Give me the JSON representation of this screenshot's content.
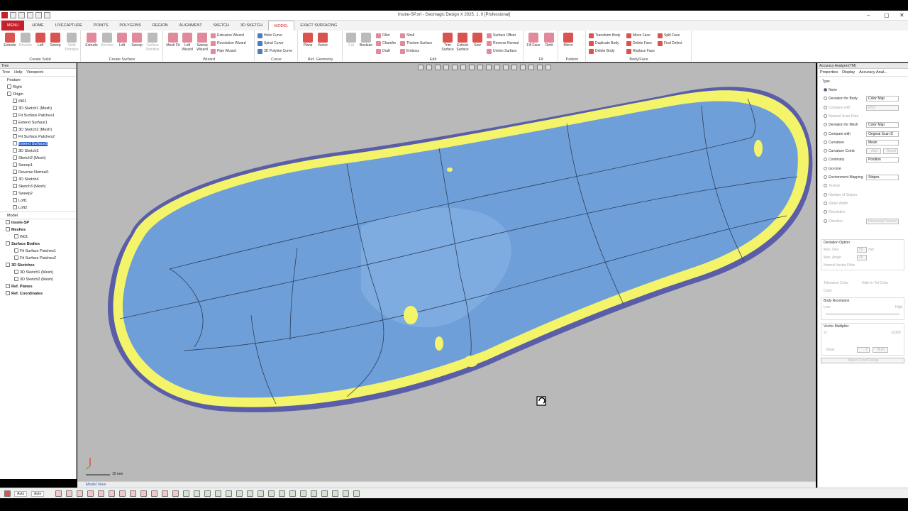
{
  "title": "Insole-SP.xrl - Geomagic Design X 2025. 1. 0 [Professional]",
  "window": {
    "minimize": "–",
    "restore": "▢",
    "close": "✕"
  },
  "menu_tabs": [
    "MENU",
    "HOME",
    "LIVECAPTURE",
    "POINTS",
    "POLYGONS",
    "REGION",
    "ALIGNMENT",
    "SKETCH",
    "3D SKETCH",
    "MODEL",
    "EXACT SURFACING"
  ],
  "active_tab": "MODEL",
  "ribbon": {
    "create_solid": {
      "label": "Create Solid",
      "buttons": [
        "Extrude",
        "Revolve",
        "Loft",
        "Sweep",
        "Solid Primitive"
      ]
    },
    "create_surface": {
      "label": "Create Surface",
      "buttons": [
        "Extrude",
        "Revolve",
        "Loft",
        "Sweep",
        "Surface Primitive"
      ]
    },
    "wizard": {
      "label": "Wizard",
      "buttons": [
        "Mesh Fit",
        "Loft Wizard",
        "Sweep Wizard"
      ],
      "small": [
        "Extrusion Wizard",
        "Revolution Wizard",
        "Pipe Wizard"
      ]
    },
    "curve": {
      "label": "Curve",
      "small": [
        "Helix Curve",
        "Spiral Curve",
        "3D Polyline Curve"
      ]
    },
    "ref_geometry": {
      "label": "Ref. Geometry",
      "buttons": [
        "Plane",
        "Vector"
      ]
    },
    "edit": {
      "label": "Edit",
      "buttons": [
        "Cut",
        "Boolean",
        "Trim Surface",
        "Extend Surface",
        "Sew"
      ],
      "small": [
        "Fillet",
        "Chamfer",
        "Draft",
        "Shell",
        "Thicken Surface",
        "Emboss",
        "Surface Offset",
        "Reverse Normal",
        "Untrim Surface"
      ]
    },
    "fit": {
      "label": "Fit",
      "buttons": [
        "Fill Face",
        "Refit"
      ]
    },
    "pattern": {
      "label": "Pattern",
      "buttons": [
        "Mirror"
      ]
    },
    "bodyface": {
      "label": "Body/Face",
      "small": [
        "Transform Body",
        "Duplicate Body",
        "Delete Body",
        "Move Face",
        "Delete Face",
        "Replace Face",
        "Split Face",
        "Find Defect"
      ]
    }
  },
  "left_panel": {
    "header": "Tree",
    "tabs": [
      "Tree",
      "Help",
      "Viewpoint"
    ],
    "feature_label": "Feature",
    "features": [
      "Right",
      "Origin",
      "iN01",
      "3D Sketch1 (Mesh)",
      "Fit Surface Patches1",
      "Extend Surface1",
      "3D Sketch2 (Mesh)",
      "Fit Surface Patches2",
      "Extend Surface2",
      "3D Sketch3",
      "Sketch2 (Mesh)",
      "Sweep1",
      "Reverse Normal1",
      "3D Sketch4",
      "Sketch3 (Mesh)",
      "Sweep2",
      "Loft1",
      "Loft2"
    ],
    "selected_feature": "Extend Surface2",
    "model_label": "Model",
    "model_tree": [
      {
        "label": "Insole-SP",
        "level": 0,
        "bold": true
      },
      {
        "label": "Meshes",
        "level": 0,
        "bold": true
      },
      {
        "label": "iN01",
        "level": 1
      },
      {
        "label": "Surface Bodies",
        "level": 0,
        "bold": true
      },
      {
        "label": "Fit Surface Patches1",
        "level": 1
      },
      {
        "label": "Fit Surface Patches2",
        "level": 1
      },
      {
        "label": "3D Sketches",
        "level": 0,
        "bold": true
      },
      {
        "label": "3D Sketch1 (Mesh)",
        "level": 1
      },
      {
        "label": "3D Sketch2 (Mesh)",
        "level": 1
      },
      {
        "label": "Ref. Planes",
        "level": 0,
        "bold": true
      },
      {
        "label": "Ref. Coordinates",
        "level": 0,
        "bold": true
      }
    ]
  },
  "canvas": {
    "scale_label": "10 mm",
    "tab": "Model View"
  },
  "right_panel": {
    "header": "Accuracy Analyzer(TM)",
    "tabs": [
      "Properties",
      "Display",
      "Accuracy Anal..."
    ],
    "type_label": "Type",
    "options": [
      {
        "label": "None",
        "value": "",
        "checked": true,
        "dim": false
      },
      {
        "label": "Deviation for Body",
        "value": "Color Map",
        "dim": false
      },
      {
        "label": "Compare with",
        "value": "iN01",
        "dim": true
      },
      {
        "label": "Nearest Scan Data",
        "value": "",
        "dim": true
      },
      {
        "label": "Deviation for Mesh",
        "value": "Color Map",
        "dim": false
      },
      {
        "label": "Compare with",
        "value": "Original Scan D",
        "dim": false
      },
      {
        "label": "Curvature",
        "value": "Mean",
        "dim": false
      },
      {
        "label": "Curvature Comb",
        "value": "",
        "dim": false
      },
      {
        "label": "Continuity",
        "value": "Position",
        "dim": false
      },
      {
        "label": "Iso-Line",
        "value": "",
        "dim": false
      },
      {
        "label": "Environment Mapping",
        "value": "Stripes",
        "dim": false
      },
      {
        "label": "Texture",
        "value": "",
        "dim": true
      },
      {
        "label": "Number of Stripes",
        "value": "",
        "dim": true
      },
      {
        "label": "Stripe Width",
        "value": "",
        "dim": true
      },
      {
        "label": "Resolution",
        "value": "",
        "dim": true
      },
      {
        "label": "Direction",
        "value": "Horizontal   Vertical",
        "dim": true
      }
    ],
    "curvature_comb_buttons": [
      "Add",
      "Reset"
    ],
    "deviation_option": {
      "label": "Deviation Option",
      "max_dev_label": "Max. Dev.",
      "max_dev": "50",
      "max_dev_unit": "mm",
      "max_angle_label": "Max. Angle",
      "max_angle": "45",
      "normal_filter": "Normal Vector Filter"
    },
    "tolerance_color": "Tolerance Color",
    "hide_in_tol": "Hide In-Tol Color",
    "color_label": "Color",
    "body_resolution": {
      "label": "Body Resolution",
      "low": "Low",
      "high": "High"
    },
    "vector_multiplier": {
      "label": "Vector Multiplier",
      "min": "x1",
      "max": "x1000",
      "value_label": "Value",
      "value": "1",
      "auto": "Auto"
    },
    "adjust_button": "Adjust Color Range"
  },
  "status": {
    "auto1": "Auto",
    "auto2": "Auto"
  },
  "colors": {
    "accent": "#c8202a",
    "surface": "#6f9fd8",
    "deviation": "#f4f46a",
    "background": "#b9b9b9"
  }
}
